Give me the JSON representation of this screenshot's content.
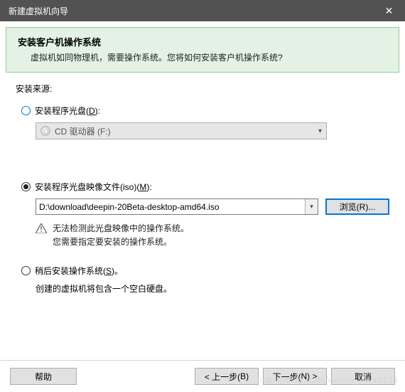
{
  "titlebar": {
    "title": "新建虚拟机向导"
  },
  "header": {
    "title": "安装客户机操作系统",
    "subtitle": "虚拟机如同物理机，需要操作系统。您将如何安装客户机操作系统?"
  },
  "source_label": "安装来源:",
  "option_disc": {
    "label_pre": "安装程序光盘(",
    "mnemonic": "D",
    "label_post": "):",
    "drive_text": "CD 驱动器 (F:)"
  },
  "option_iso": {
    "label_pre": "安装程序光盘映像文件(iso)(",
    "mnemonic": "M",
    "label_post": "):",
    "path": "D:\\download\\deepin-20Beta-desktop-amd64.iso",
    "browse_pre": "浏览(",
    "browse_mn": "R",
    "browse_post": ")...",
    "warn_line1": "无法检测此光盘映像中的操作系统。",
    "warn_line2": "您需要指定要安装的操作系统。"
  },
  "option_later": {
    "label_pre": "稍后安装操作系统(",
    "mnemonic": "S",
    "label_post": ")。",
    "hint": "创建的虚拟机将包含一个空白硬盘。"
  },
  "footer": {
    "help": "帮助",
    "back_pre": "< 上一步(",
    "back_mn": "B",
    "back_post": ")",
    "next_pre": "下一步(",
    "next_mn": "N",
    "next_post": ") >",
    "cancel": "取消"
  },
  "watermark": "https://blog.csdn/weixin_xxxx8134"
}
